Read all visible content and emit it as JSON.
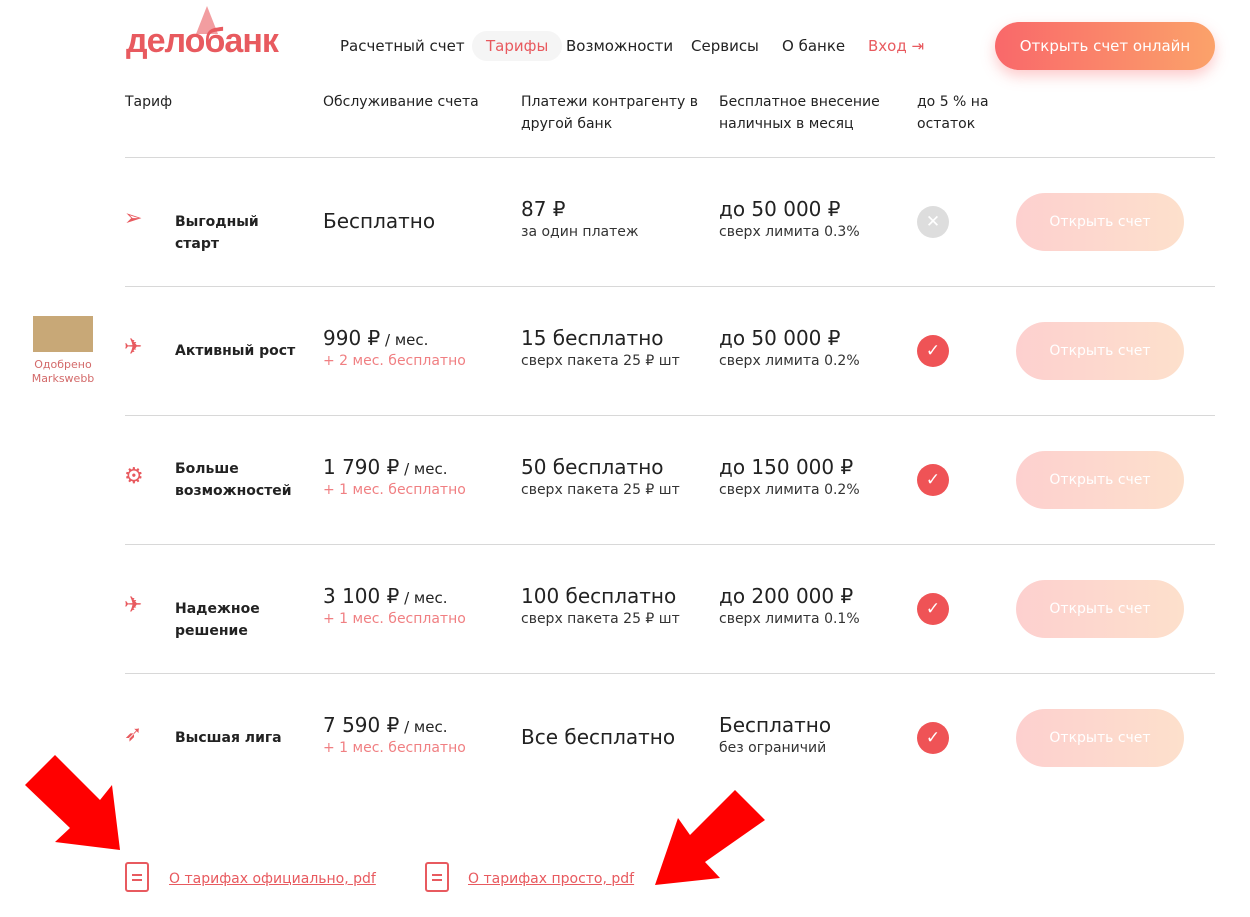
{
  "header": {
    "logo": "делобанк",
    "nav": [
      "Расчетный счет",
      "Тарифы",
      "Возможности",
      "Сервисы",
      "О банке"
    ],
    "login": "Вход",
    "cta": "Открыть счет онлайн"
  },
  "columns": [
    "Тариф",
    "Обслуживание счета",
    "Платежи контрагенту в другой банк",
    "Бесплатное внесение наличных в месяц",
    "до 5 % на остаток"
  ],
  "rows": [
    {
      "icon": "paper-plane-icon",
      "name": "Выгодный старт",
      "price": "Бесплатно",
      "price_unit": "",
      "promo": "",
      "payments": "87 ₽",
      "payments_sub": "за один платеж",
      "cash": "до 50 000 ₽",
      "cash_sub": "сверх лимита 0.3%",
      "interest": false,
      "button": "Открыть счет"
    },
    {
      "icon": "biplane-icon",
      "name": "Активный рост",
      "price": "990 ₽",
      "price_unit": " / мес.",
      "promo": "+ 2 мес. бесплатно",
      "payments": "15 бесплатно",
      "payments_sub": "сверх пакета 25 ₽ шт",
      "cash": "до 50 000 ₽",
      "cash_sub": "сверх лимита 0.2%",
      "interest": true,
      "button": "Открыть счет"
    },
    {
      "icon": "helicopter-icon",
      "name": "Больше возможностей",
      "price": "1 790 ₽",
      "price_unit": " / мес.",
      "promo": "+ 1 мес. бесплатно",
      "payments": "50 бесплатно",
      "payments_sub": "сверх пакета 25 ₽ шт",
      "cash": "до 150 000 ₽",
      "cash_sub": "сверх лимита 0.2%",
      "interest": true,
      "button": "Открыть счет"
    },
    {
      "icon": "airplane-icon",
      "name": "Надежное решение",
      "price": "3 100 ₽",
      "price_unit": " / мес.",
      "promo": "+ 1 мес. бесплатно",
      "payments": "100 бесплатно",
      "payments_sub": "сверх пакета 25 ₽ шт",
      "cash": "до 200 000 ₽",
      "cash_sub": "сверх лимита 0.1%",
      "interest": true,
      "button": "Открыть счет"
    },
    {
      "icon": "rocket-icon",
      "name": "Высшая лига",
      "price": "7 590 ₽",
      "price_unit": " / мес.",
      "promo": "+ 1 мес. бесплатно",
      "payments": "Все бесплатно",
      "payments_sub": "",
      "cash": "Бесплатно",
      "cash_sub": "без ограничий",
      "interest": true,
      "button": "Открыть счет"
    }
  ],
  "badge": "Одобрено Markswebb",
  "docs": [
    "О тарифах официально, pdf",
    "О тарифах просто, pdf"
  ],
  "colors": {
    "accent": "#e85a5f",
    "check": "#ef5356",
    "annotation": "#ff0000"
  }
}
